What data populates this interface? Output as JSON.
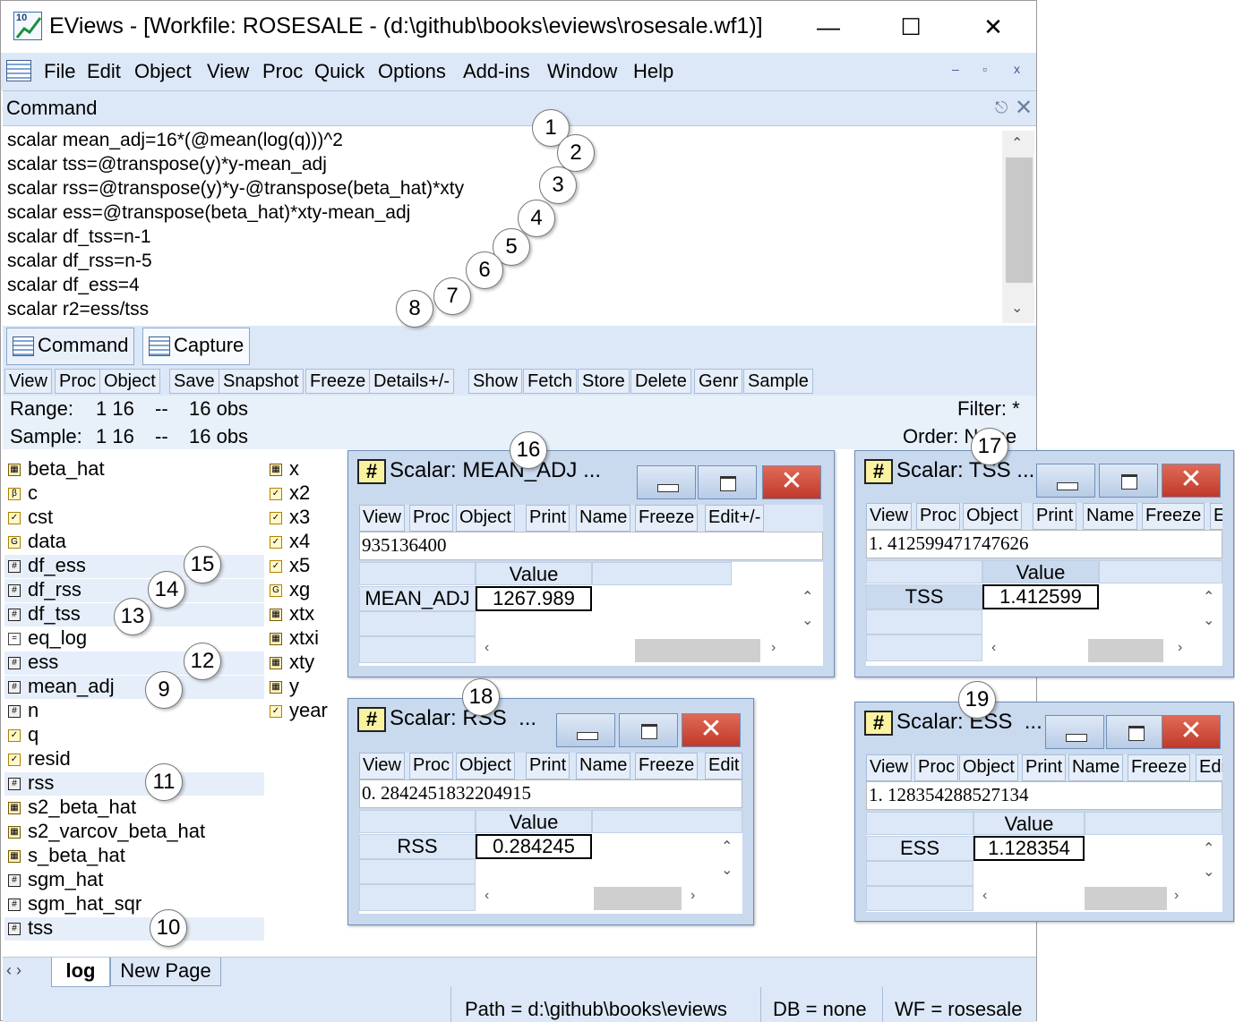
{
  "window": {
    "title": "EViews - [Workfile: ROSESALE - (d:\\github\\books\\eviews\\rosesale.wf1)]",
    "app_icon_label": "10",
    "minimize_glyph": "—",
    "maximize_glyph": "☐",
    "close_glyph": "✕"
  },
  "menu": [
    "File",
    "Edit",
    "Object",
    "View",
    "Proc",
    "Quick",
    "Options",
    "Add-ins",
    "Window",
    "Help"
  ],
  "mdi_controls": [
    "–",
    "▫",
    "x"
  ],
  "command_pane": {
    "title": "Command",
    "lines": [
      "scalar mean_adj=16*(@mean(log(q)))^2",
      "scalar tss=@transpose(y)*y-mean_adj",
      "scalar rss=@transpose(y)*y-@transpose(beta_hat)*xty",
      "scalar ess=@transpose(beta_hat)*xty-mean_adj",
      "scalar df_tss=n-1",
      "scalar df_rss=n-5",
      "scalar df_ess=4",
      "scalar r2=ess/tss"
    ],
    "tabs": [
      "Command",
      "Capture"
    ]
  },
  "workfile_toolbar": [
    "View",
    "Proc",
    "Object",
    "Save",
    "Snapshot",
    "Freeze",
    "Details+/-",
    "Show",
    "Fetch",
    "Store",
    "Delete",
    "Genr",
    "Sample"
  ],
  "range": {
    "range_label": "Range:",
    "range_value": "1 16",
    "range_sep": "--",
    "range_obs": "16 obs",
    "sample_label": "Sample:",
    "sample_value": "1 16",
    "sample_sep": "--",
    "sample_obs": "16 obs",
    "filter": "Filter: *",
    "order": "Order: Name"
  },
  "objects_col1": [
    {
      "name": "beta_hat",
      "type": "matrix"
    },
    {
      "name": "c",
      "type": "coef"
    },
    {
      "name": "cst",
      "type": "series"
    },
    {
      "name": "data",
      "type": "group"
    },
    {
      "name": "df_ess",
      "type": "scalar"
    },
    {
      "name": "df_rss",
      "type": "scalar"
    },
    {
      "name": "df_tss",
      "type": "scalar"
    },
    {
      "name": "eq_log",
      "type": "equation"
    },
    {
      "name": "ess",
      "type": "scalar"
    },
    {
      "name": "mean_adj",
      "type": "scalar"
    },
    {
      "name": "n",
      "type": "scalar"
    },
    {
      "name": "q",
      "type": "series"
    },
    {
      "name": "resid",
      "type": "series"
    },
    {
      "name": "rss",
      "type": "scalar"
    },
    {
      "name": "s2_beta_hat",
      "type": "matrix"
    },
    {
      "name": "s2_varcov_beta_hat",
      "type": "matrix"
    },
    {
      "name": "s_beta_hat",
      "type": "matrix"
    },
    {
      "name": "sgm_hat",
      "type": "scalar"
    },
    {
      "name": "sgm_hat_sqr",
      "type": "scalar"
    },
    {
      "name": "tss",
      "type": "scalar"
    }
  ],
  "objects_col2": [
    {
      "name": "x",
      "type": "matrix"
    },
    {
      "name": "x2",
      "type": "series"
    },
    {
      "name": "x3",
      "type": "series"
    },
    {
      "name": "x4",
      "type": "series"
    },
    {
      "name": "x5",
      "type": "series"
    },
    {
      "name": "xg",
      "type": "group"
    },
    {
      "name": "xtx",
      "type": "matrix"
    },
    {
      "name": "xtxi",
      "type": "matrix"
    },
    {
      "name": "xty",
      "type": "matrix"
    },
    {
      "name": "y",
      "type": "matrix"
    },
    {
      "name": "year",
      "type": "series"
    }
  ],
  "page_tabs": [
    "log",
    "New Page"
  ],
  "nav_arrows": "‹ ›",
  "status": {
    "path": "Path = d:\\github\\books\\eviews",
    "db": "DB = none",
    "wf": "WF = rosesale"
  },
  "scalar_windows": {
    "mean_adj": {
      "title": "Scalar: MEAN_ADJ",
      "ellipsis": "...",
      "toolbar": [
        "View",
        "Proc",
        "Object",
        "Print",
        "Name",
        "Freeze",
        "Edit+/-"
      ],
      "full_value": "935136400",
      "header": "Value",
      "row_label": "MEAN_ADJ",
      "cell": "1267.989"
    },
    "tss": {
      "title": "Scalar: TSS",
      "ellipsis": "...",
      "toolbar": [
        "View",
        "Proc",
        "Object",
        "Print",
        "Name",
        "Freeze",
        "E"
      ],
      "full_value": "1. 412599471747626",
      "header": "Value",
      "row_label": "TSS",
      "cell": "1.412599"
    },
    "rss": {
      "title": "Scalar: RSS",
      "ellipsis": "...",
      "toolbar": [
        "View",
        "Proc",
        "Object",
        "Print",
        "Name",
        "Freeze",
        "Edit"
      ],
      "full_value": "0. 2842451832204915",
      "header": "Value",
      "row_label": "RSS",
      "cell": "0.284245"
    },
    "ess": {
      "title": "Scalar: ESS",
      "ellipsis": "...",
      "toolbar": [
        "View",
        "Proc",
        "Object",
        "Print",
        "Name",
        "Freeze",
        "Edit"
      ],
      "full_value": "1. 128354288527134",
      "header": "Value",
      "row_label": "ESS",
      "cell": "1.128354"
    }
  },
  "callouts": [
    "1",
    "2",
    "3",
    "4",
    "5",
    "6",
    "7",
    "8",
    "9",
    "10",
    "11",
    "12",
    "13",
    "14",
    "15",
    "16",
    "17",
    "18",
    "19"
  ],
  "colors": {
    "chrome": "#dce8f7",
    "highlight": "#e6eef9",
    "close_red": "#c0392b"
  }
}
